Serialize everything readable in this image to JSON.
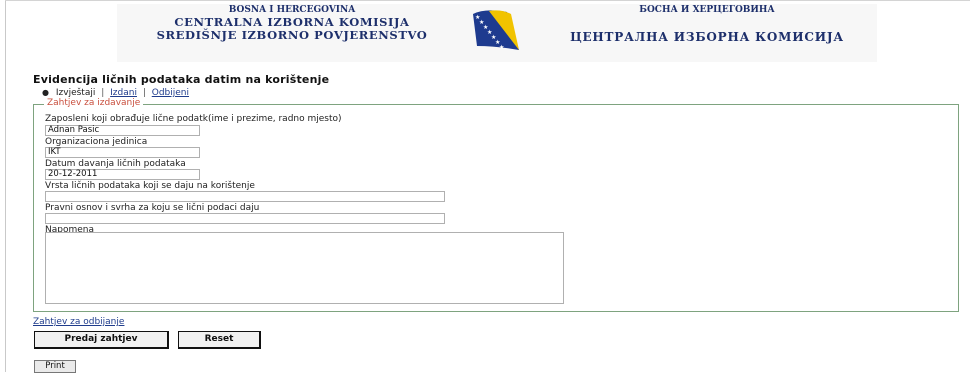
{
  "header": {
    "latin_line1": "BOSNA I HERCEGOVINA",
    "latin_line2": "CENTRALNA IZBORNA KOMISIJA",
    "latin_line3": "SREDIŠNJE IZBORNO POVJERENSTVO",
    "cyrillic_line1": "БОСНА И ХЕРЦЕГОВИНА",
    "cyrillic_line2": "ЦЕНТРАЛНА ИЗБОРНА КОМИСИЈА",
    "colors": {
      "text": "#1d2f6b",
      "flag_blue": "#1e3b8f",
      "flag_yellow": "#f1c300"
    }
  },
  "page_title": "Evidencija ličnih podataka datim na korištenje",
  "tabs": {
    "item1": "Izvještaji",
    "item2": "Izdani",
    "item3": "Odbijeni",
    "separator": "|"
  },
  "form": {
    "legend": "Zahtjev za izdavanje",
    "fields": {
      "employee": {
        "label": "Zaposleni koji obrađuje lične podatk(ime i prezime, radno mjesto)",
        "value": "Adnan Pasic"
      },
      "org_unit": {
        "label": "Organizaciona jedinica",
        "value": "IKT"
      },
      "date": {
        "label": "Datum davanja ličnih podataka",
        "value": "20-12-2011"
      },
      "data_type": {
        "label": "Vrsta ličnih podataka koji se daju na korištenje",
        "value": ""
      },
      "legal_basis": {
        "label": "Pravni osnov i svrha za koju se lični podaci daju",
        "value": ""
      },
      "note": {
        "label": "Napomena",
        "value": ""
      }
    }
  },
  "link_odbijanje": "Zahtjev za odbijanje",
  "buttons": {
    "submit": "Predaj zahtjev",
    "reset": "Reset",
    "print": "Print"
  },
  "colors": {
    "legend": "#c94f3e",
    "fieldset_border": "#7ea37f",
    "link": "#1f3c8c"
  }
}
